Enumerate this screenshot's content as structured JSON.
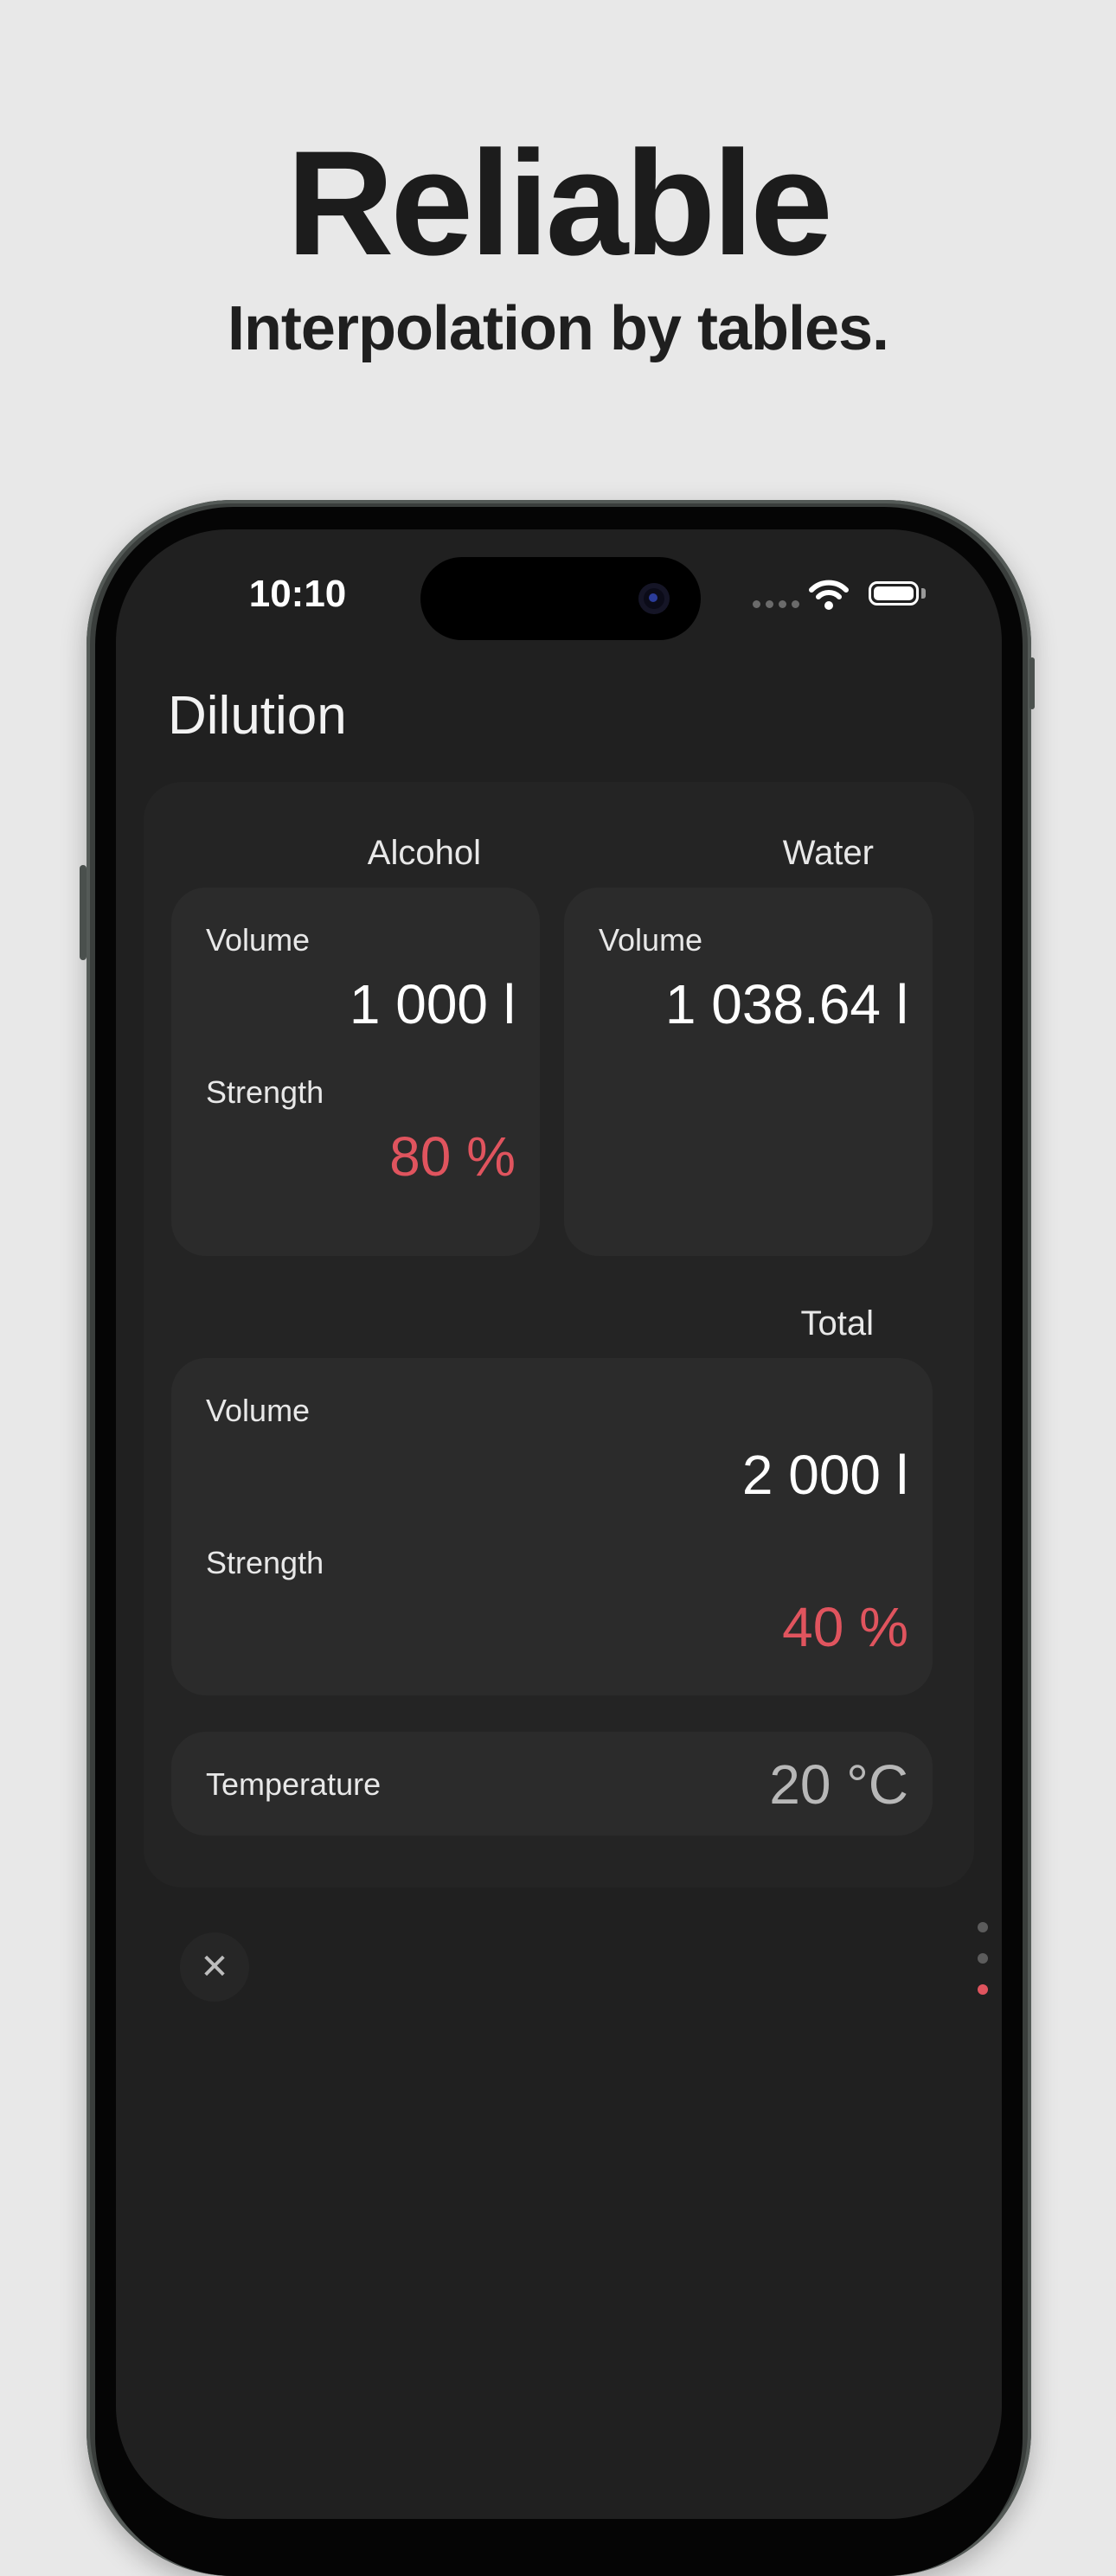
{
  "marketing": {
    "headline": "Reliable",
    "subline": "Interpolation by tables."
  },
  "status_bar": {
    "time": "10:10",
    "icons": [
      "signal-dots-icon",
      "wifi-icon",
      "battery-icon"
    ]
  },
  "screen": {
    "title": "Dilution",
    "alcohol": {
      "header": "Alcohol",
      "volume_label": "Volume",
      "volume_value": "1 000 l",
      "strength_label": "Strength",
      "strength_value": "80 %"
    },
    "water": {
      "header": "Water",
      "volume_label": "Volume",
      "volume_value": "1 038.64 l"
    },
    "total": {
      "header": "Total",
      "volume_label": "Volume",
      "volume_value": "2 000 l",
      "strength_label": "Strength",
      "strength_value": "40 %"
    },
    "temperature": {
      "label": "Temperature",
      "value": "20 °C"
    },
    "close_icon": "close-icon",
    "page_indicator": {
      "count": 3,
      "active_index": 2,
      "active_color": "#e0545e"
    }
  },
  "colors": {
    "accent_red": "#e0545e",
    "background": "#202020",
    "card": "#2b2b2b"
  }
}
